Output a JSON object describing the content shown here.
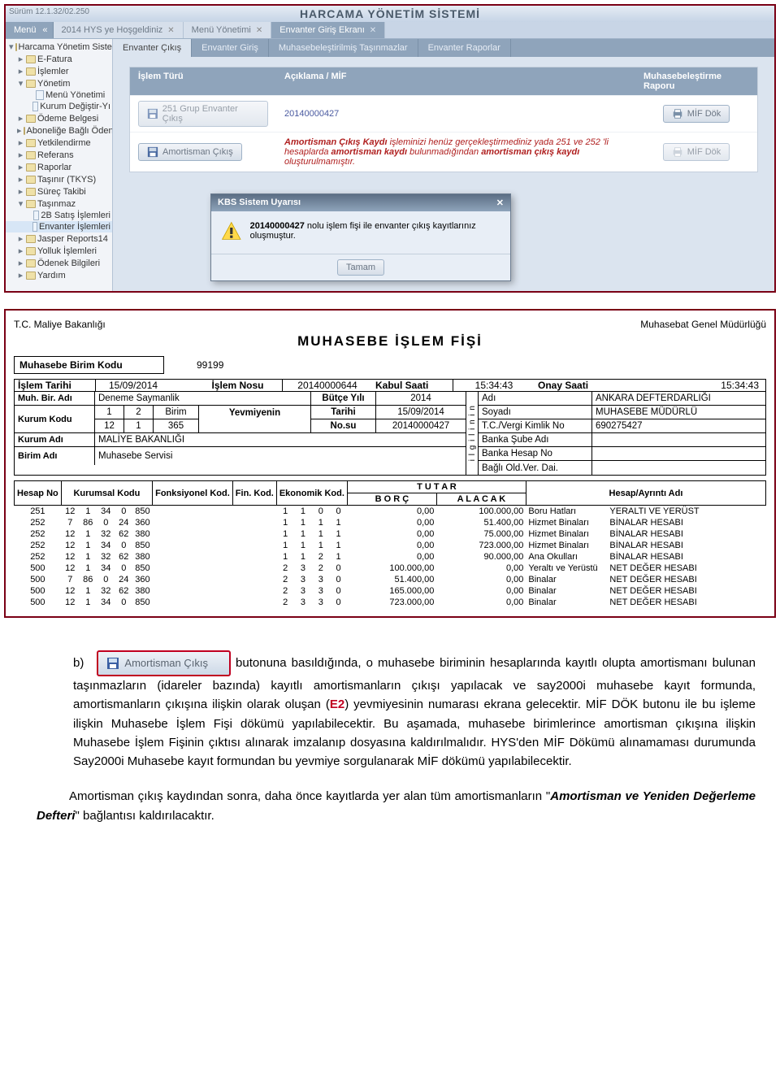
{
  "app": {
    "version": "Sürüm 12.1.32/02.250",
    "title": "HARCAMA YÖNETİM SİSTEMİ",
    "menu_btn": "Menü",
    "tabs": [
      {
        "label": "2014 HYS ye Hoşgeldiniz"
      },
      {
        "label": "Menü Yönetimi"
      },
      {
        "label": "Envanter Giriş Ekranı",
        "active": true
      }
    ],
    "sidebar": {
      "items": [
        {
          "lvl": 0,
          "tw": "▾",
          "t": "folder",
          "label": "Harcama Yönetim Sisten"
        },
        {
          "lvl": 1,
          "tw": "▸",
          "t": "folder",
          "label": "E-Fatura"
        },
        {
          "lvl": 1,
          "tw": "▸",
          "t": "folder",
          "label": "İşlemler"
        },
        {
          "lvl": 1,
          "tw": "▾",
          "t": "folder",
          "label": "Yönetim"
        },
        {
          "lvl": 2,
          "tw": "",
          "t": "page",
          "label": "Menü Yönetimi"
        },
        {
          "lvl": 2,
          "tw": "",
          "t": "page",
          "label": "Kurum Değiştir-Yı"
        },
        {
          "lvl": 1,
          "tw": "▸",
          "t": "folder",
          "label": "Ödeme Belgesi"
        },
        {
          "lvl": 1,
          "tw": "▸",
          "t": "folder",
          "label": "Aboneliğe Bağlı Öden"
        },
        {
          "lvl": 1,
          "tw": "▸",
          "t": "folder",
          "label": "Yetkilendirme"
        },
        {
          "lvl": 1,
          "tw": "▸",
          "t": "folder",
          "label": "Referans"
        },
        {
          "lvl": 1,
          "tw": "▸",
          "t": "folder",
          "label": "Raporlar"
        },
        {
          "lvl": 1,
          "tw": "▸",
          "t": "folder",
          "label": "Taşınır (TKYS)"
        },
        {
          "lvl": 1,
          "tw": "▸",
          "t": "folder",
          "label": "Süreç Takibi"
        },
        {
          "lvl": 1,
          "tw": "▾",
          "t": "folder",
          "label": "Taşınmaz"
        },
        {
          "lvl": 2,
          "tw": "",
          "t": "page",
          "label": "2B Satış İşlemleri"
        },
        {
          "lvl": 2,
          "tw": "",
          "t": "page",
          "label": "Envanter İşlemleri",
          "sel": true
        },
        {
          "lvl": 1,
          "tw": "▸",
          "t": "folder",
          "label": "Jasper Reports14"
        },
        {
          "lvl": 1,
          "tw": "▸",
          "t": "folder",
          "label": "Yolluk İşlemleri"
        },
        {
          "lvl": 1,
          "tw": "▸",
          "t": "folder",
          "label": "Ödenek Bilgileri"
        },
        {
          "lvl": 1,
          "tw": "▸",
          "t": "folder",
          "label": "Yardım"
        }
      ]
    },
    "subtabs": [
      {
        "label": "Envanter Çıkış",
        "active": true
      },
      {
        "label": "Envanter Giriş"
      },
      {
        "label": "Muhasebeleştirilmiş Taşınmazlar"
      },
      {
        "label": "Envanter Raporlar"
      }
    ],
    "panel": {
      "cols": [
        "İşlem Türü",
        "Açıklama / MİF",
        "Muhasebeleştirme Raporu"
      ],
      "rows": [
        {
          "btn": "251 Grup Envanter Çıkış",
          "desc": "20140000427",
          "mif": "MİF Dök",
          "disabled": false
        },
        {
          "btn": "Amortisman Çıkış",
          "desc_html": {
            "pre": "Amortisman Çıkış Kaydı",
            "body": " işleminizi henüz gerçekleştirmediniz yada 251 ve 252 'li hesaplarda ",
            "mid": "amortisman kaydı",
            "body2": " bulunmadığından ",
            "mid2": "amortisman çıkış kaydı",
            "tail": " oluşturulmamıştır."
          },
          "mif": "MİF Dök",
          "disabled": true
        }
      ]
    },
    "modal": {
      "title": "KBS Sistem Uyarısı",
      "body_pre": "20140000427",
      "body_post": " nolu işlem fişi ile envanter çıkış kayıtlarınız oluşmuştur.",
      "ok": "Tamam"
    }
  },
  "mif": {
    "ministry": "T.C. Maliye Bakanlığı",
    "dept": "Muhasebat Genel Müdürlüğü",
    "title": "MUHASEBE  İŞLEM   FİŞİ",
    "unit_code_label": "Muhasebe Birim Kodu",
    "unit_code": "99199",
    "meta": {
      "islem_tarihi_l": "İşlem Tarihi",
      "islem_tarihi": "15/09/2014",
      "islem_nosu_l": "İşlem Nosu",
      "islem_nosu": "20140000644",
      "kabul_saati_l": "Kabul  Saati",
      "kabul_saati": "15:34:43",
      "onay_saati_l": "Onay  Saati",
      "onay_saati": "15:34:43",
      "muh_bir_adi_l": "Muh. Bir. Adı",
      "muh_bir_adi": "Deneme Saymanlik",
      "butce_yili_l": "Bütçe Yılı",
      "butce_yili": "2014",
      "kurum_kodu_l": "Kurum Kodu",
      "kurum_kodu1": "1",
      "kurum_kodu2": "2",
      "kurum_kodu_birim": "Birim",
      "kurum_kodu_row2a": "12",
      "kurum_kodu_row2b": "1",
      "kurum_kodu_row2c": "365",
      "yevmiyenin": "Yevmiyenin",
      "tarihi_l": "Tarihi",
      "tarihi": "15/09/2014",
      "nosu_l": "No.su",
      "nosu": "20140000427",
      "kurum_adi_l": "Kurum Adı",
      "kurum_adi": "MALİYE BAKANLIĞI",
      "birim_adi_l": "Birim Adı",
      "birim_adi": "Muhasebe Servisi",
      "ilgilinin": "ilgilinin",
      "adi_l": "Adı",
      "adi": "ANKARA DEFTERDARLIĞI",
      "soyadi_l": "Soyadı",
      "soyadi": "MUHASEBE MÜDÜRLÜ",
      "tc_l": "T.C./Vergi Kimlik No",
      "tc": "690275427",
      "banka_sube_l": "Banka Şube Adı",
      "banka_sube": "",
      "banka_hesap_l": "Banka Hesap No",
      "banka_hesap": "",
      "bagli_l": "Bağlı Old.Ver. Dai.",
      "bagli": ""
    },
    "thead": {
      "hesap": "Hesap No",
      "kurumsal": "Kurumsal Kodu",
      "fonks": "Fonksiyonel Kod.",
      "fin": "Fin. Kod.",
      "eko": "Ekonomik Kod.",
      "tutar": "T  U  T  A  R",
      "borc": "B  O  R  Ç",
      "alacak": "A  L  A  C  A  K",
      "hesapAdi": "Hesap/Ayrıntı Adı"
    },
    "rows": [
      {
        "h": "251",
        "k": [
          "12",
          "1",
          "34",
          "0",
          "850"
        ],
        "e": [
          "1",
          "1",
          "0",
          "0"
        ],
        "b": "0,00",
        "a": "100.000,00",
        "d1": "Boru Hatları",
        "d2": "YERALTI VE YERÜST"
      },
      {
        "h": "252",
        "k": [
          "7",
          "86",
          "0",
          "24",
          "360"
        ],
        "e": [
          "1",
          "1",
          "1",
          "1"
        ],
        "b": "0,00",
        "a": "51.400,00",
        "d1": "Hizmet Binaları",
        "d2": "BİNALAR HESABI"
      },
      {
        "h": "252",
        "k": [
          "12",
          "1",
          "32",
          "62",
          "380"
        ],
        "e": [
          "1",
          "1",
          "1",
          "1"
        ],
        "b": "0,00",
        "a": "75.000,00",
        "d1": "Hizmet Binaları",
        "d2": "BİNALAR HESABI"
      },
      {
        "h": "252",
        "k": [
          "12",
          "1",
          "34",
          "0",
          "850"
        ],
        "e": [
          "1",
          "1",
          "1",
          "1"
        ],
        "b": "0,00",
        "a": "723.000,00",
        "d1": "Hizmet Binaları",
        "d2": "BİNALAR HESABI"
      },
      {
        "h": "252",
        "k": [
          "12",
          "1",
          "32",
          "62",
          "380"
        ],
        "e": [
          "1",
          "1",
          "2",
          "1"
        ],
        "b": "0,00",
        "a": "90.000,00",
        "d1": "Ana Okulları",
        "d2": "BİNALAR HESABI"
      },
      {
        "h": "500",
        "k": [
          "12",
          "1",
          "34",
          "0",
          "850"
        ],
        "e": [
          "2",
          "3",
          "2",
          "0"
        ],
        "b": "100.000,00",
        "a": "0,00",
        "d1": "Yeraltı ve Yerüstü",
        "d2": "NET DEĞER HESABI"
      },
      {
        "h": "500",
        "k": [
          "7",
          "86",
          "0",
          "24",
          "360"
        ],
        "e": [
          "2",
          "3",
          "3",
          "0"
        ],
        "b": "51.400,00",
        "a": "0,00",
        "d1": "Binalar",
        "d2": "NET DEĞER HESABI"
      },
      {
        "h": "500",
        "k": [
          "12",
          "1",
          "32",
          "62",
          "380"
        ],
        "e": [
          "2",
          "3",
          "3",
          "0"
        ],
        "b": "165.000,00",
        "a": "0,00",
        "d1": "Binalar",
        "d2": "NET DEĞER HESABI"
      },
      {
        "h": "500",
        "k": [
          "12",
          "1",
          "34",
          "0",
          "850"
        ],
        "e": [
          "2",
          "3",
          "3",
          "0"
        ],
        "b": "723.000,00",
        "a": "0,00",
        "d1": "Binalar",
        "d2": "NET DEĞER HESABI"
      }
    ]
  },
  "para": {
    "b_letter": "b)",
    "btn": "Amortisman Çıkış",
    "t1": "butonuna basıldığında, o muhasebe biriminin hesaplarında kayıtlı olupta amortismanı bulunan taşınmazların (idareler bazında) kayıtlı amortismanların çıkışı yapılacak ve say2000i muhasebe kayıt formunda, amortismanların çıkışına ilişkin olarak oluşan (",
    "e2": "E2",
    "t2": ") yevmiyesinin numarası ekrana gelecektir. MİF DÖK butonu ile bu işleme ilişkin Muhasebe İşlem Fişi dökümü yapılabilecektir. Bu aşamada, muhasebe birimlerince amortisman çıkışına ilişkin Muhasebe İşlem Fişinin çıktısı alınarak imzalanıp dosyasına kaldırılmalıdır. HYS'den MİF Dökümü alınamaması durumunda Say2000i Muhasebe kayıt formundan bu yevmiye sorgulanarak MİF dökümü yapılabilecektir.",
    "p2a": "Amortisman çıkış kaydından sonra, daha önce kayıtlarda yer alan tüm amortismanların \"",
    "p2b": "Amortisman ve Yeniden Değerleme Defteri",
    "p2c": "\" bağlantısı kaldırılacaktır."
  }
}
